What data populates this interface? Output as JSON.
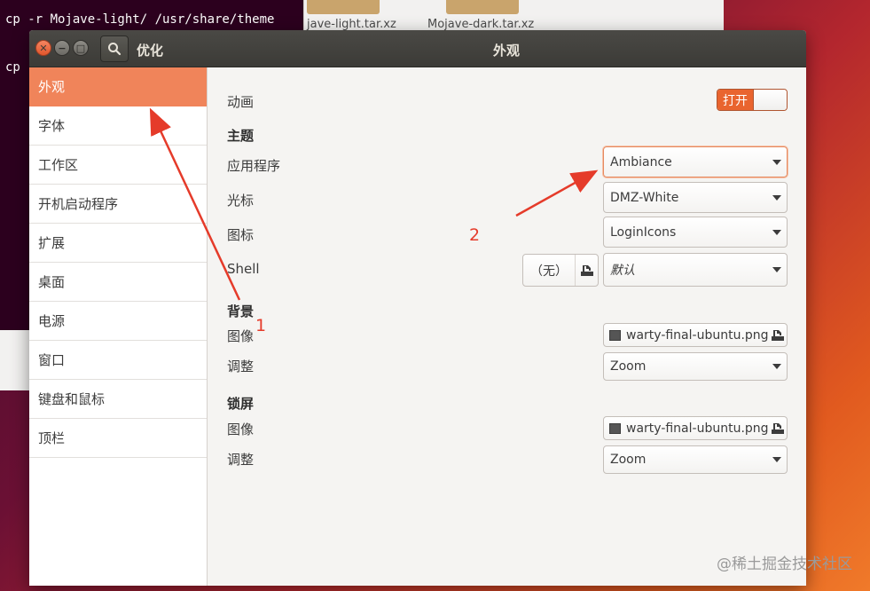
{
  "background": {
    "terminal": {
      "line1": "cp -r Mojave-light/ /usr/share/theme",
      "line2": "cp"
    },
    "files": [
      {
        "name": "jave-light.tar.xz"
      },
      {
        "name": "Mojave-dark.tar.xz"
      }
    ]
  },
  "window": {
    "left_title": "优化",
    "center_title": "外观",
    "buttons": {
      "close": "✕",
      "minimize": "−",
      "maximize": "□"
    }
  },
  "sidebar": {
    "items": [
      {
        "label": "外观",
        "active": true
      },
      {
        "label": "字体"
      },
      {
        "label": "工作区"
      },
      {
        "label": "开机启动程序"
      },
      {
        "label": "扩展"
      },
      {
        "label": "桌面"
      },
      {
        "label": "电源"
      },
      {
        "label": "窗口"
      },
      {
        "label": "键盘和鼠标"
      },
      {
        "label": "顶栏"
      }
    ]
  },
  "appearance": {
    "animation": {
      "label": "动画",
      "toggle_label": "打开"
    },
    "theme": {
      "section": "主题",
      "application": {
        "label": "应用程序",
        "value": "Ambiance"
      },
      "cursor": {
        "label": "光标",
        "value": "DMZ-White"
      },
      "icons": {
        "label": "图标",
        "value": "LoginIcons"
      },
      "shell": {
        "label": "Shell",
        "file_value": "（无）",
        "value": "默认"
      }
    },
    "background": {
      "section": "背景",
      "image": {
        "label": "图像",
        "value": "warty-final-ubuntu.png"
      },
      "adjust": {
        "label": "调整",
        "value": "Zoom"
      }
    },
    "lockscreen": {
      "section": "锁屏",
      "image": {
        "label": "图像",
        "value": "warty-final-ubuntu.png"
      },
      "adjust": {
        "label": "调整",
        "value": "Zoom"
      }
    }
  },
  "annotations": {
    "label_1": "1",
    "label_2": "2",
    "color": "#e53b2a"
  },
  "watermark": "@稀土掘金技术社区"
}
